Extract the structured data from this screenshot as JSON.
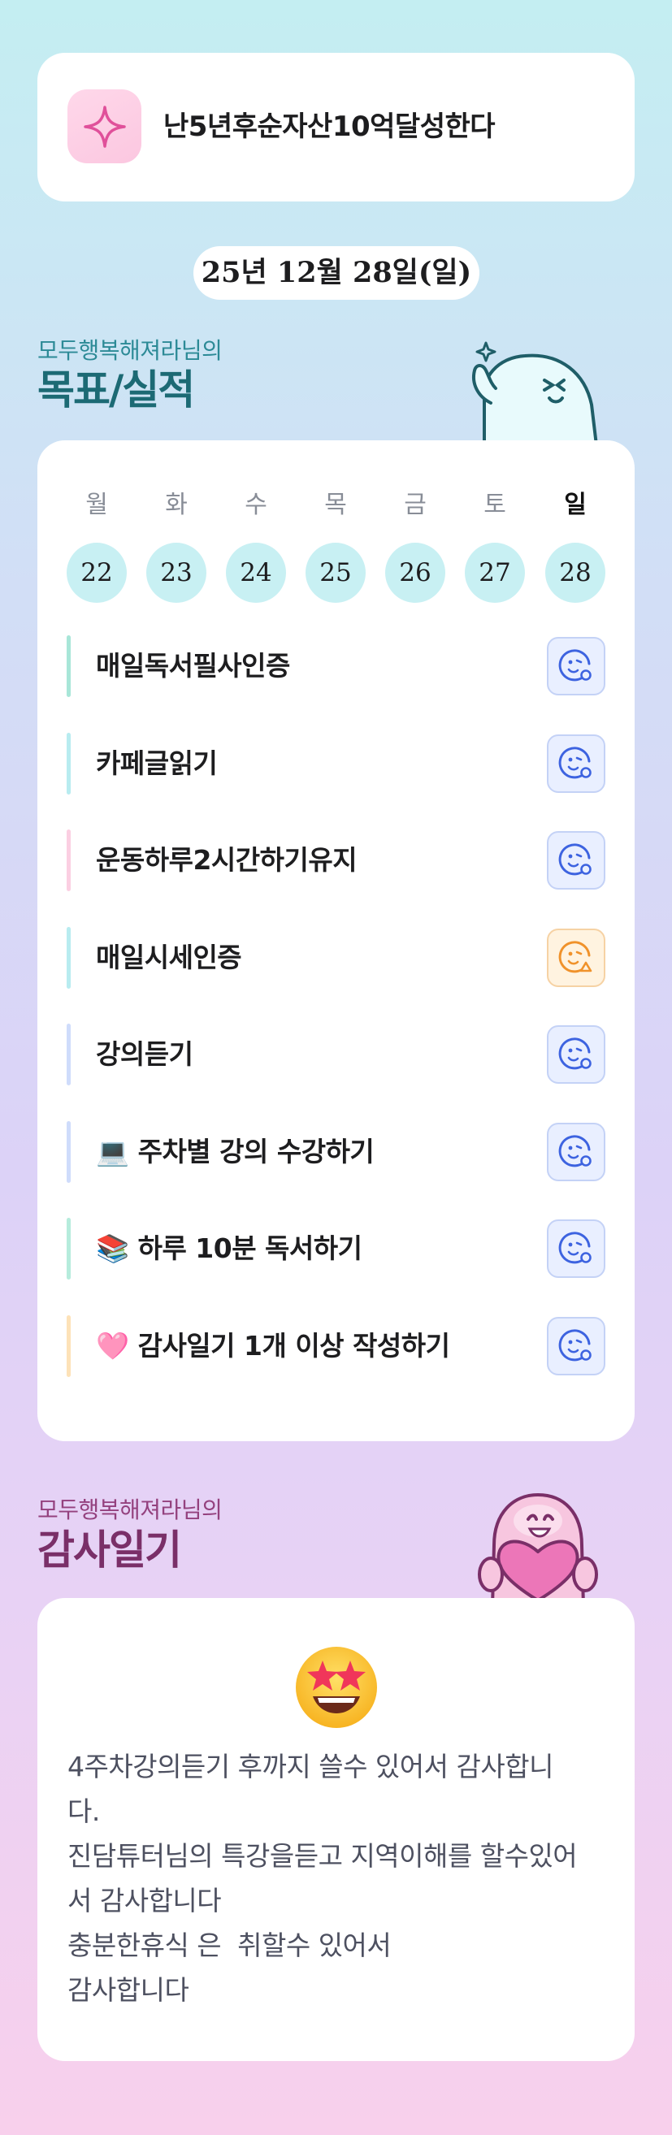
{
  "goal": {
    "title": "난5년후순자산10억달성한다",
    "icon": "sparkle-icon"
  },
  "date_label": "25년 12월 28일(일)",
  "goals_section": {
    "subtitle": "모두행복해져라님의",
    "title": "목표/실적"
  },
  "week": {
    "days": [
      {
        "label": "월",
        "date": "22"
      },
      {
        "label": "화",
        "date": "23"
      },
      {
        "label": "수",
        "date": "24"
      },
      {
        "label": "목",
        "date": "25"
      },
      {
        "label": "금",
        "date": "26"
      },
      {
        "label": "토",
        "date": "27"
      },
      {
        "label": "일",
        "date": "28"
      }
    ]
  },
  "tasks": [
    {
      "text": "매일독서필사인증",
      "bar_color": "#a8e6d8",
      "status": "smile-check-icon"
    },
    {
      "text": "카페글읽기",
      "bar_color": "#b8ecf0",
      "status": "smile-check-icon"
    },
    {
      "text": "운동하루2시간하기유지",
      "bar_color": "#fbcfe2",
      "status": "smile-check-icon"
    },
    {
      "text": "매일시세인증",
      "bar_color": "#b8ecf0",
      "status": "smile-warning-icon"
    },
    {
      "text": "강의듣기",
      "bar_color": "#cfdcfb",
      "status": "smile-check-icon"
    },
    {
      "text": "💻 주차별 강의 수강하기",
      "bar_color": "#cfdcfb",
      "status": "smile-check-icon"
    },
    {
      "text": "📚 하루 10분 독서하기",
      "bar_color": "#b6ecdc",
      "status": "smile-check-icon"
    },
    {
      "text": "🩷 감사일기 1개 이상 작성하기",
      "bar_color": "#fde2b8",
      "status": "smile-check-icon"
    }
  ],
  "thanks_section": {
    "subtitle": "모두행복해져라님의",
    "title": "감사일기"
  },
  "thanks": {
    "emoji": "star-struck-emoji-icon",
    "body": "4주차강의듣기 후까지 쓸수 있어서 감사합니\n다.\n진담튜터님의 특강을듣고 지역이해를 할수있어\n서 감사합니다\n충분한휴식 은  취할수 있어서\n감사합니다"
  },
  "colors": {
    "accent_teal": "#1c6a74",
    "accent_plum": "#7a2f68",
    "check_blue": "#3d63e0",
    "warn_orange": "#f0922b"
  }
}
